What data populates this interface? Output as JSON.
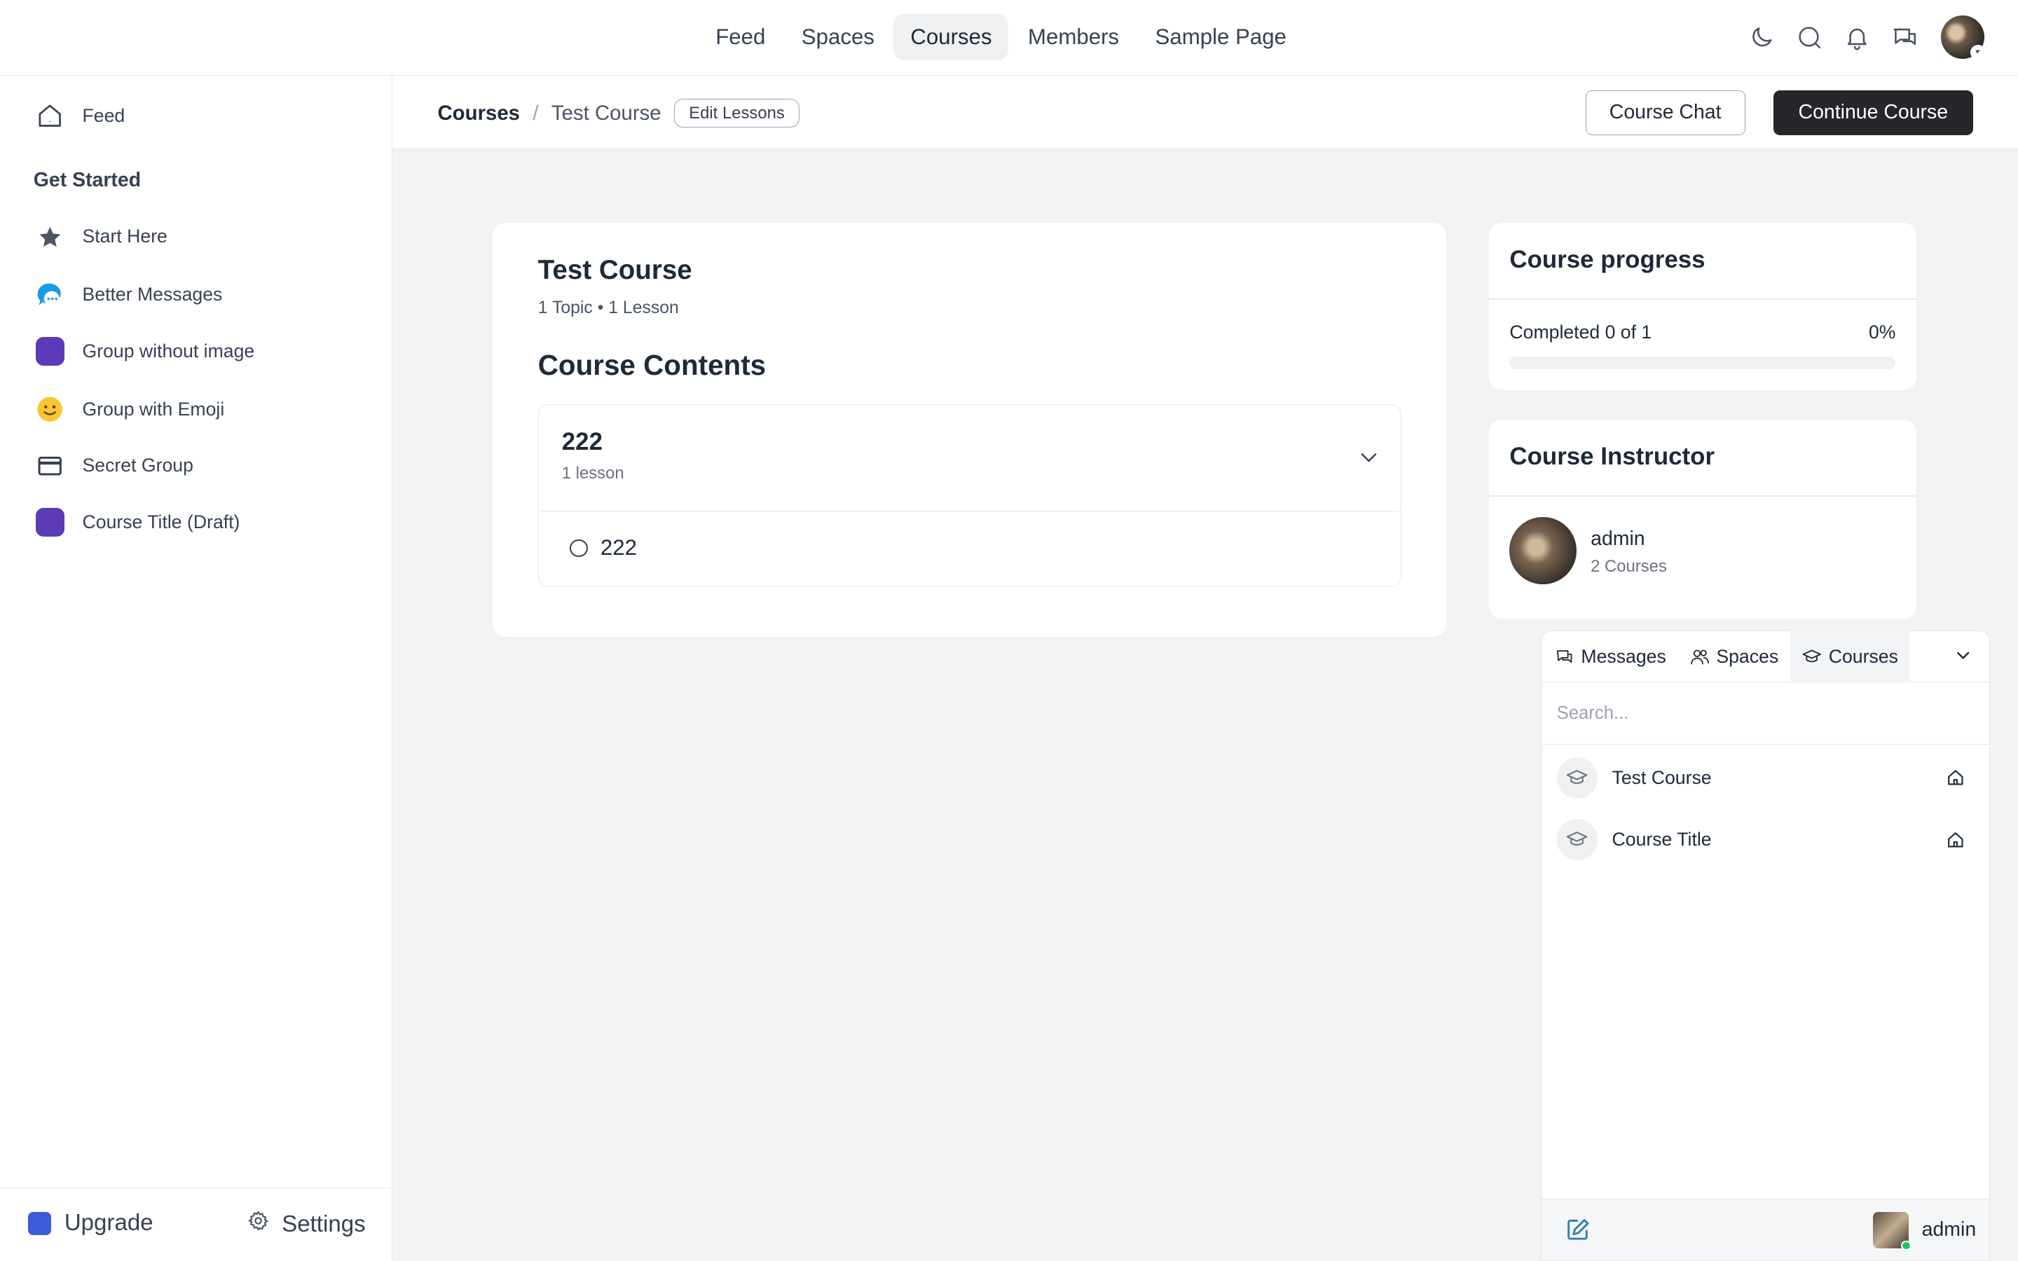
{
  "topnav": {
    "items": [
      {
        "label": "Feed"
      },
      {
        "label": "Spaces"
      },
      {
        "label": "Courses",
        "active": true
      },
      {
        "label": "Members"
      },
      {
        "label": "Sample Page"
      }
    ],
    "icons": [
      "moon-icon",
      "search-icon",
      "bell-icon",
      "chat-icon",
      "avatar"
    ]
  },
  "sidebar": {
    "feed_label": "Feed",
    "section_title": "Get Started",
    "items": [
      {
        "label": "Start Here",
        "icon": "star-icon"
      },
      {
        "label": "Better Messages",
        "icon": "chat-bubble-icon"
      },
      {
        "label": "Group without image",
        "icon": "purple-square-icon"
      },
      {
        "label": "Group with Emoji",
        "icon": "slightly-smiling-emoji-icon",
        "glyph": "🙂"
      },
      {
        "label": "Secret Group",
        "icon": "card-icon"
      },
      {
        "label": "Course Title (Draft)",
        "icon": "purple-square-icon"
      }
    ],
    "upgrade_label": "Upgrade",
    "settings_label": "Settings"
  },
  "subheader": {
    "breadcrumb_root": "Courses",
    "breadcrumb_separator": "/",
    "breadcrumb_current": "Test Course",
    "edit_lessons_label": "Edit Lessons",
    "course_chat_label": "Course Chat",
    "continue_label": "Continue Course"
  },
  "course": {
    "title": "Test Course",
    "meta": "1 Topic • 1 Lesson",
    "contents_title": "Course Contents",
    "topic": {
      "name": "222",
      "count": "1 lesson",
      "lessons": [
        {
          "name": "222"
        }
      ]
    }
  },
  "progress": {
    "title": "Course progress",
    "text": "Completed 0 of 1",
    "percent_label": "0%",
    "fraction": 0
  },
  "instructor": {
    "title": "Course Instructor",
    "name": "admin",
    "courses": "2 Courses"
  },
  "chat_widget": {
    "tabs": [
      {
        "label": "Messages",
        "icon": "messages-icon"
      },
      {
        "label": "Spaces",
        "icon": "people-icon"
      },
      {
        "label": "Courses",
        "icon": "graduation-cap-icon",
        "active": true
      }
    ],
    "search_placeholder": "Search...",
    "rows": [
      {
        "name": "Test Course"
      },
      {
        "name": "Course Title"
      }
    ],
    "user_name": "admin"
  },
  "colors": {
    "accent_dark": "#25272b",
    "group_purple": "#5b3bb8",
    "page_bg": "#f1f2f4",
    "online": "#22c55e"
  }
}
